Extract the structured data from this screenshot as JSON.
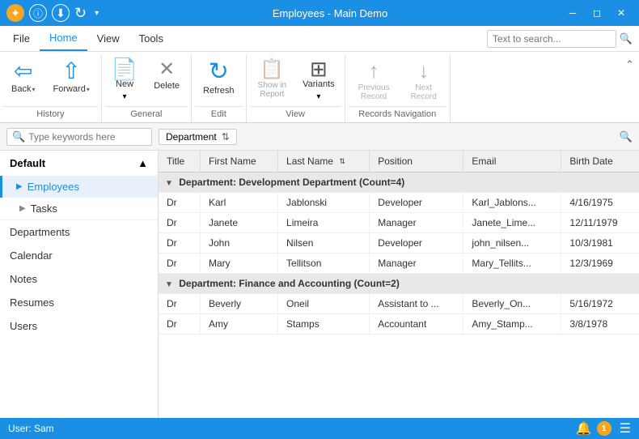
{
  "titleBar": {
    "title": "Employees - Main Demo",
    "controls": [
      "minimize",
      "restore",
      "close"
    ]
  },
  "menuBar": {
    "items": [
      "File",
      "Home",
      "View",
      "Tools"
    ],
    "activeItem": "Home",
    "searchPlaceholder": "Text to search..."
  },
  "ribbon": {
    "groups": {
      "history": {
        "label": "History",
        "buttons": [
          {
            "id": "back",
            "label": "Back",
            "icon": "←",
            "arrow": true,
            "disabled": false
          },
          {
            "id": "forward",
            "label": "Forward",
            "icon": "→",
            "arrow": true,
            "disabled": false
          }
        ]
      },
      "general": {
        "label": "General",
        "buttons": [
          {
            "id": "new",
            "label": "New",
            "icon": "📄",
            "arrow": true,
            "disabled": false
          },
          {
            "id": "delete",
            "label": "Delete",
            "icon": "✕",
            "disabled": false
          }
        ]
      },
      "edit": {
        "label": "Edit",
        "buttons": [
          {
            "id": "refresh",
            "label": "Refresh",
            "icon": "↻",
            "disabled": false
          }
        ]
      },
      "view": {
        "label": "View",
        "buttons": [
          {
            "id": "show-in-report",
            "label": "Show in\nReport",
            "icon": "📋",
            "disabled": true
          },
          {
            "id": "variants",
            "label": "Variants",
            "icon": "🔲",
            "arrow": true,
            "disabled": false
          }
        ]
      },
      "navigation": {
        "label": "Records Navigation",
        "buttons": [
          {
            "id": "previous-record",
            "label": "Previous\nRecord",
            "icon": "↑",
            "disabled": true
          },
          {
            "id": "next-record",
            "label": "Next\nRecord",
            "icon": "↓",
            "disabled": true
          }
        ]
      }
    }
  },
  "filterBar": {
    "searchPlaceholder": "Type keywords here",
    "activeFilter": "Department"
  },
  "sidebar": {
    "defaultLabel": "Default",
    "items": [
      {
        "id": "employees",
        "label": "Employees",
        "hasArrow": true,
        "active": true
      },
      {
        "id": "tasks",
        "label": "Tasks",
        "hasArrow": true,
        "active": false
      },
      {
        "id": "departments",
        "label": "Departments",
        "active": false
      },
      {
        "id": "calendar",
        "label": "Calendar",
        "active": false
      },
      {
        "id": "notes",
        "label": "Notes",
        "active": false
      },
      {
        "id": "resumes",
        "label": "Resumes",
        "active": false
      },
      {
        "id": "users",
        "label": "Users",
        "active": false
      }
    ]
  },
  "table": {
    "columns": [
      "Title",
      "First Name",
      "Last Name",
      "Position",
      "Email",
      "Birth Date"
    ],
    "groups": [
      {
        "name": "Department: Development Department (Count=4)",
        "rows": [
          {
            "title": "Dr",
            "firstName": "Karl",
            "lastName": "Jablonski",
            "position": "Developer",
            "email": "Karl_Jablons...",
            "birthDate": "4/16/1975"
          },
          {
            "title": "Dr",
            "firstName": "Janete",
            "lastName": "Limeira",
            "position": "Manager",
            "email": "Janete_Lime...",
            "birthDate": "12/11/1979"
          },
          {
            "title": "Dr",
            "firstName": "John",
            "lastName": "Nilsen",
            "position": "Developer",
            "email": "john_nilsen...",
            "birthDate": "10/3/1981"
          },
          {
            "title": "Dr",
            "firstName": "Mary",
            "lastName": "Tellitson",
            "position": "Manager",
            "email": "Mary_Tellits...",
            "birthDate": "12/3/1969"
          }
        ]
      },
      {
        "name": "Department: Finance and Accounting (Count=2)",
        "rows": [
          {
            "title": "Dr",
            "firstName": "Beverly",
            "lastName": "Oneil",
            "position": "Assistant to ...",
            "email": "Beverly_On...",
            "birthDate": "5/16/1972"
          },
          {
            "title": "Dr",
            "firstName": "Amy",
            "lastName": "Stamps",
            "position": "Accountant",
            "email": "Amy_Stamp...",
            "birthDate": "3/8/1978"
          }
        ]
      }
    ]
  },
  "statusBar": {
    "user": "User: Sam",
    "notificationCount": "1"
  },
  "colors": {
    "primary": "#1a8fe3",
    "accent": "#f5a623"
  }
}
